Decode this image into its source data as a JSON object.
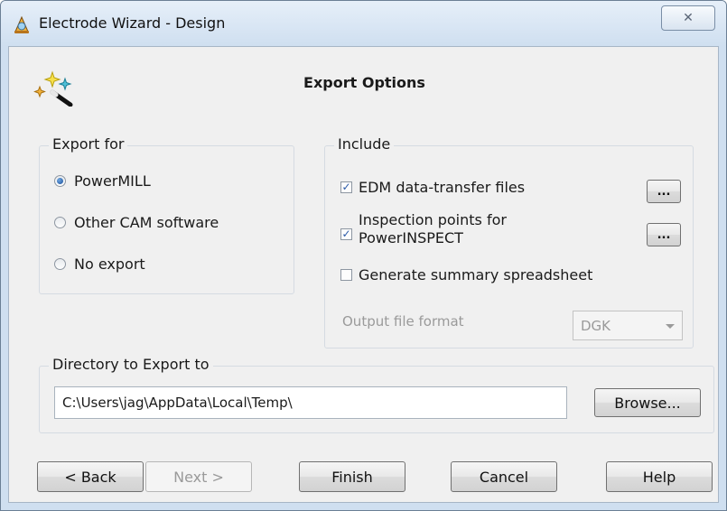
{
  "window": {
    "title": "Electrode Wizard - Design",
    "close_glyph": "✕"
  },
  "page": {
    "heading": "Export Options"
  },
  "export_for": {
    "title": "Export for",
    "options": [
      "PowerMILL",
      "Other CAM software",
      "No export"
    ],
    "selected": "PowerMILL"
  },
  "include": {
    "title": "Include",
    "edm_label": "EDM data-transfer files",
    "edm_checked": true,
    "edm_browse": "...",
    "inspection_label_line1": "Inspection points for",
    "inspection_label_line2": "PowerINSPECT",
    "inspection_checked": true,
    "inspection_browse": "...",
    "summary_label": "Generate summary spreadsheet",
    "summary_checked": false,
    "output_format_label": "Output file format",
    "output_format_value": "DGK"
  },
  "directory": {
    "title": "Directory to Export to",
    "path": "C:\\Users\\jag\\AppData\\Local\\Temp\\",
    "browse_label": "Browse..."
  },
  "buttons": {
    "back": "< Back",
    "next": "Next >",
    "finish": "Finish",
    "cancel": "Cancel",
    "help": "Help"
  },
  "icons": {
    "app": "wizard-hat-icon",
    "wizard": "magic-wand-icon",
    "close": "close-icon"
  }
}
